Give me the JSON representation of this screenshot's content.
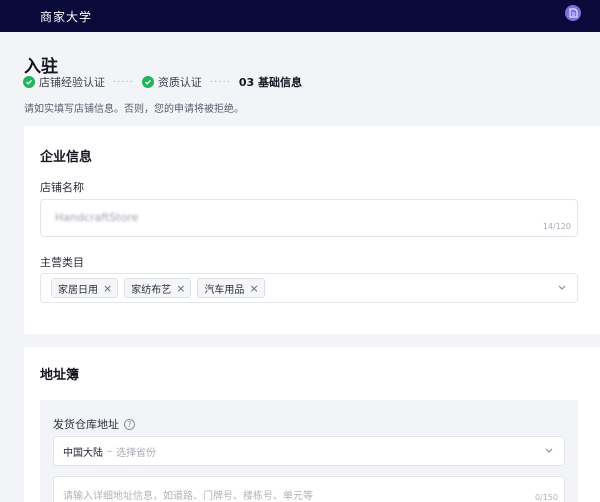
{
  "topbar": {
    "title": "商家大学",
    "avatar_icon": "document-icon"
  },
  "page": {
    "title": "入驻",
    "steps": [
      {
        "label": "店铺经验认证",
        "status": "done"
      },
      {
        "label": "资质认证",
        "status": "done"
      },
      {
        "label": "03 基础信息",
        "status": "current"
      }
    ],
    "step_separator": "·····",
    "notice": "请如实填写店铺信息。否则，您的申请将被拒绝。"
  },
  "company": {
    "title": "企业信息",
    "store_name": {
      "label": "店铺名称",
      "value": "HandcraftStore",
      "counter": "14/120"
    },
    "category": {
      "label": "主营类目",
      "tags": [
        "家居日用",
        "家纺布艺",
        "汽车用品"
      ],
      "remove_symbol": "×"
    }
  },
  "address": {
    "title": "地址簿",
    "warehouse": {
      "label": "发货仓库地址",
      "help_symbol": "?",
      "country": "中国大陆",
      "separator": "–",
      "province_placeholder": "选择省份",
      "detail_placeholder": "请输入详细地址信息，如道路、门牌号、楼栋号、单元等",
      "detail_counter": "0/150"
    }
  },
  "colors": {
    "topbar": "#0a0a3a",
    "avatar": "#7b6ee6",
    "success": "#22b45a"
  }
}
